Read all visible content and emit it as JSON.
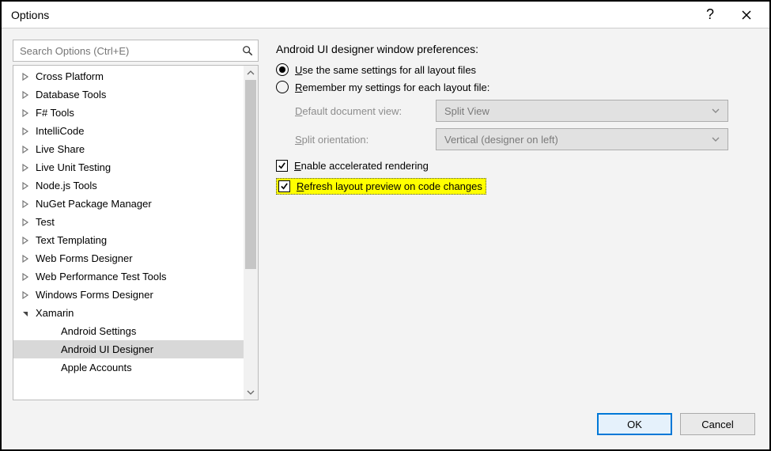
{
  "window": {
    "title": "Options"
  },
  "search": {
    "placeholder": "Search Options (Ctrl+E)"
  },
  "tree": {
    "items": [
      {
        "label": "Cross Platform",
        "expander": "collapsed"
      },
      {
        "label": "Database Tools",
        "expander": "collapsed"
      },
      {
        "label": "F# Tools",
        "expander": "collapsed"
      },
      {
        "label": "IntelliCode",
        "expander": "collapsed"
      },
      {
        "label": "Live Share",
        "expander": "collapsed"
      },
      {
        "label": "Live Unit Testing",
        "expander": "collapsed"
      },
      {
        "label": "Node.js Tools",
        "expander": "collapsed"
      },
      {
        "label": "NuGet Package Manager",
        "expander": "collapsed"
      },
      {
        "label": "Test",
        "expander": "collapsed"
      },
      {
        "label": "Text Templating",
        "expander": "collapsed"
      },
      {
        "label": "Web Forms Designer",
        "expander": "collapsed"
      },
      {
        "label": "Web Performance Test Tools",
        "expander": "collapsed"
      },
      {
        "label": "Windows Forms Designer",
        "expander": "collapsed"
      },
      {
        "label": "Xamarin",
        "expander": "expanded",
        "children": [
          {
            "label": "Android Settings"
          },
          {
            "label": "Android UI Designer",
            "selected": true
          },
          {
            "label": "Apple Accounts"
          }
        ]
      }
    ]
  },
  "panel": {
    "heading": "Android UI designer window preferences:",
    "radio1": {
      "prefix": "U",
      "rest": "se the same settings for all layout files",
      "checked": true
    },
    "radio2": {
      "prefix": "R",
      "rest": "emember my settings for each layout file:",
      "checked": false
    },
    "row1_label_u": "D",
    "row1_label_rest": "efault document view:",
    "row1_value": "Split View",
    "row2_label_u": "S",
    "row2_label_rest": "plit orientation:",
    "row2_value": "Vertical (designer on left)",
    "check1": {
      "prefix": "E",
      "rest": "nable accelerated rendering",
      "checked": true
    },
    "check2": {
      "prefix": "R",
      "rest": "efresh layout preview on code changes",
      "checked": true
    }
  },
  "buttons": {
    "ok": "OK",
    "cancel": "Cancel"
  }
}
